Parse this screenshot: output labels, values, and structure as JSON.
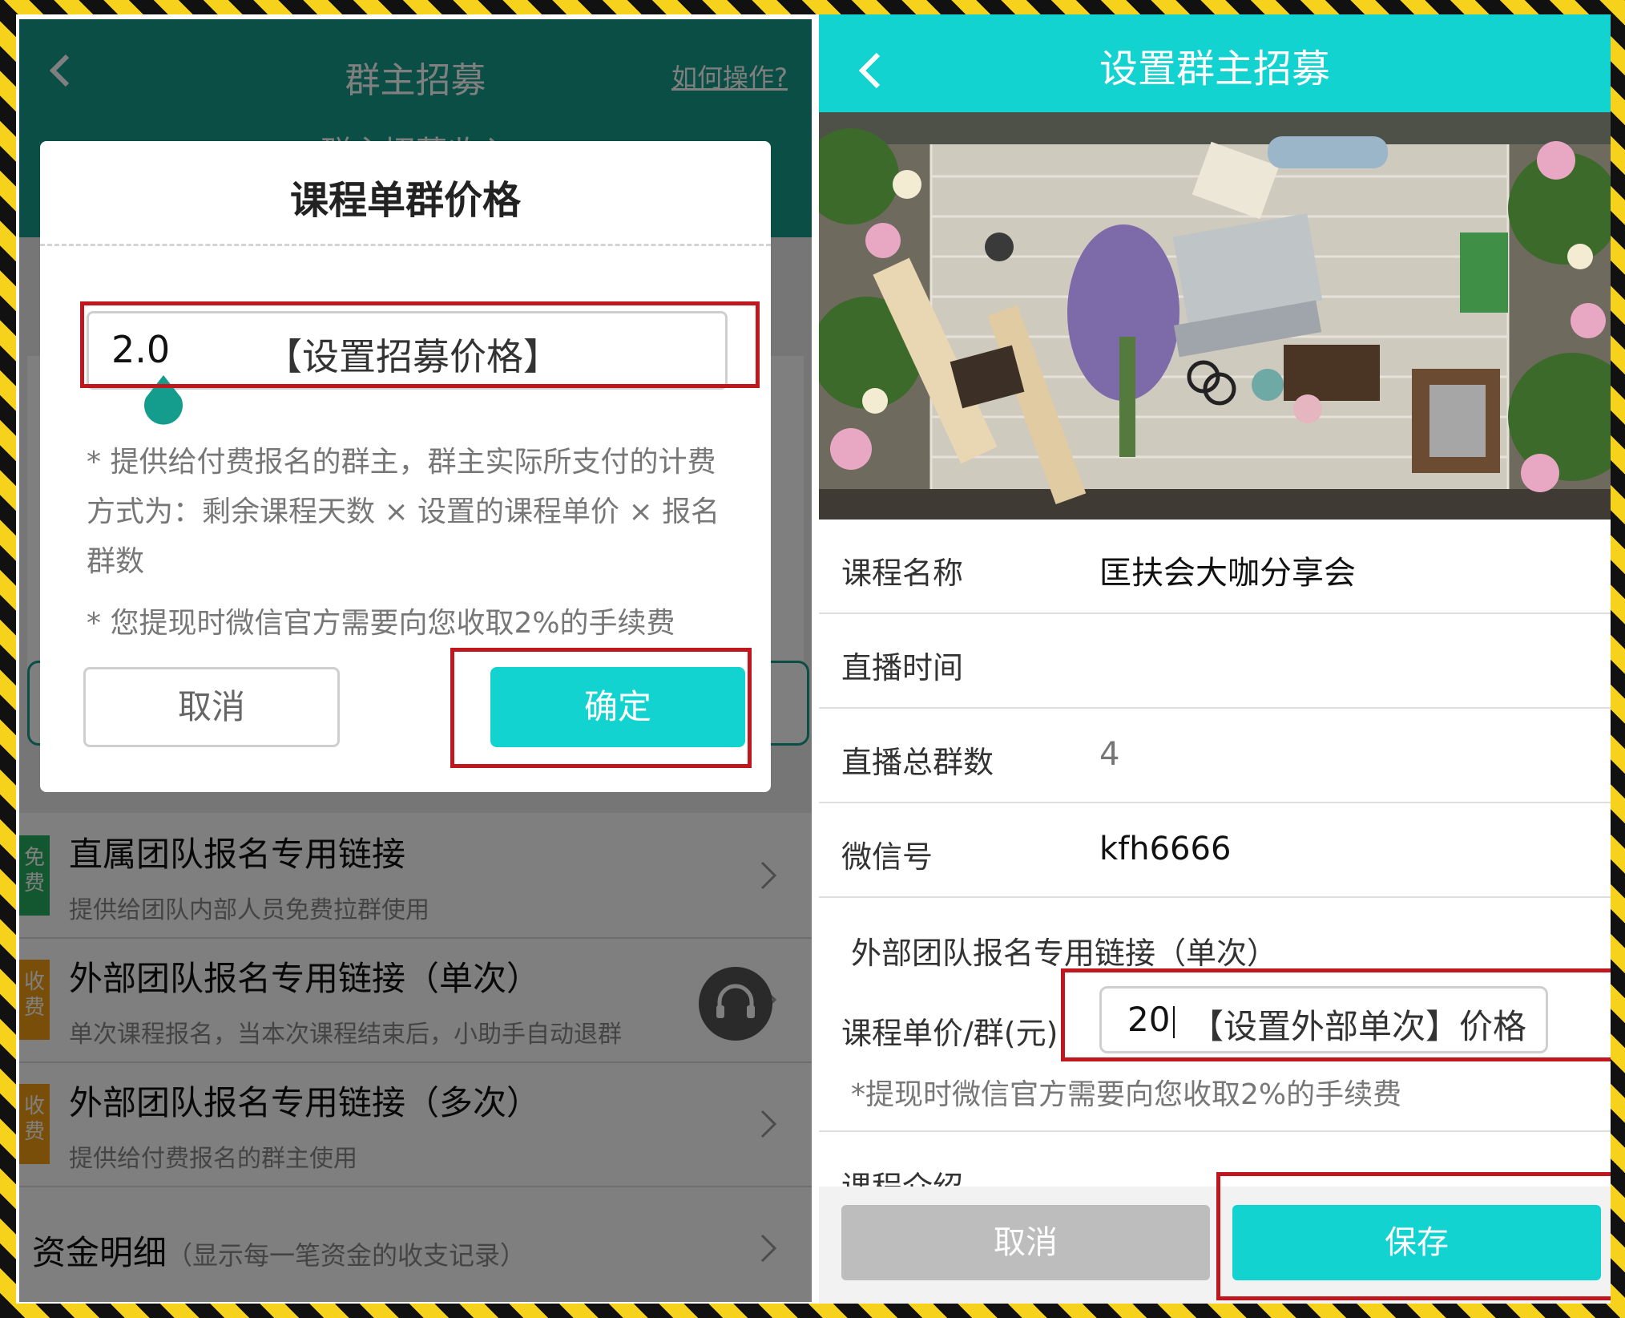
{
  "left": {
    "header": {
      "title": "群主招募",
      "help_link": "如何操作?",
      "subtitle": "群主招募收入"
    },
    "dialog": {
      "title": "课程单群价格",
      "input_value": "2.0",
      "input_hint": "【设置招募价格】",
      "note": "* 提供给付费报名的群主，群主实际所支付的计费方式为：剩余课程天数 × 设置的课程单价 × 报名群数",
      "note_fee": "* 您提现时微信官方需要向您收取2%的手续费",
      "cancel_label": "取消",
      "confirm_label": "确定"
    },
    "list": [
      {
        "badge": "免费",
        "title": "直属团队报名专用链接",
        "subtitle": "提供给团队内部人员免费拉群使用"
      },
      {
        "badge": "收费",
        "title": "外部团队报名专用链接（单次）",
        "subtitle": "单次课程报名，当本次课程结束后，小助手自动退群"
      },
      {
        "badge": "收费",
        "title": "外部团队报名专用链接（多次）",
        "subtitle": "提供给付费报名的群主使用"
      }
    ],
    "funds": {
      "title": "资金明细",
      "note": "（显示每一笔资金的收支记录）"
    }
  },
  "right": {
    "header": {
      "title": "设置群主招募"
    },
    "fields": [
      {
        "label": "课程名称",
        "value": "匡扶会大咖分享会"
      },
      {
        "label": "直播时间",
        "value": ""
      },
      {
        "label": "直播总群数",
        "value": "4"
      },
      {
        "label": "微信号",
        "value": "kfh6666"
      }
    ],
    "section": {
      "title": "外部团队报名专用链接（单次）",
      "price_label": "课程单价/群(元)",
      "price_value": "20",
      "price_hint": "【设置外部单次】价格",
      "fee_note": "*提现时微信官方需要向您收取2%的手续费"
    },
    "intro_label": "课程介绍",
    "cancel_label": "取消",
    "save_label": "保存"
  },
  "colors": {
    "teal_header": "#149d8c",
    "cyan_accent": "#13d3d1",
    "highlight_red": "#c0161d",
    "stripe_yellow": "#f6d21c"
  }
}
